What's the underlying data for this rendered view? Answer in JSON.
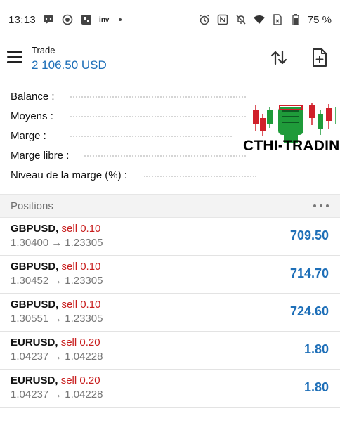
{
  "status_bar": {
    "time": "13:13",
    "left_icons": [
      "messenger-icon",
      "record-icon",
      "app-icon"
    ],
    "left_text": "inv",
    "right_icons": [
      "alarm-icon",
      "nfc-icon",
      "mute-icon",
      "wifi-icon",
      "sim-icon",
      "battery-icon"
    ],
    "battery": "75 %"
  },
  "header": {
    "title": "Trade",
    "subtitle": "2 106.50 USD",
    "menu_icon": "hamburger-menu-icon",
    "sort_icon": "sort-arrows-icon",
    "new_order_icon": "new-order-icon"
  },
  "summary": {
    "balance_label": "Balance :",
    "equity_label": "Moyens :",
    "margin_label": "Marge :",
    "free_margin_label": "Marge libre :",
    "margin_level_label": "Niveau de la marge (%) :"
  },
  "watermark": {
    "text": "CTHI-TRADIN"
  },
  "positions": {
    "header": "Positions",
    "more_icon": "more-dots-icon",
    "items": [
      {
        "symbol": "GBPUSD,",
        "side": "sell 0.10",
        "open_price": "1.30400",
        "arrow": "→",
        "current_price": "1.23305",
        "profit": "709.50"
      },
      {
        "symbol": "GBPUSD,",
        "side": "sell 0.10",
        "open_price": "1.30452",
        "arrow": "→",
        "current_price": "1.23305",
        "profit": "714.70"
      },
      {
        "symbol": "GBPUSD,",
        "side": "sell 0.10",
        "open_price": "1.30551",
        "arrow": "→",
        "current_price": "1.23305",
        "profit": "724.60"
      },
      {
        "symbol": "EURUSD,",
        "side": "sell 0.20",
        "open_price": "1.04237",
        "arrow": "→",
        "current_price": "1.04228",
        "profit": "1.80"
      },
      {
        "symbol": "EURUSD,",
        "side": "sell 0.20",
        "open_price": "1.04237",
        "arrow": "→",
        "current_price": "1.04228",
        "profit": "1.80"
      }
    ]
  },
  "colors": {
    "accent_blue": "#1e6fb8",
    "sell_red": "#c81e1e",
    "logo_green": "#1f9b3a",
    "logo_red": "#d0202a"
  }
}
